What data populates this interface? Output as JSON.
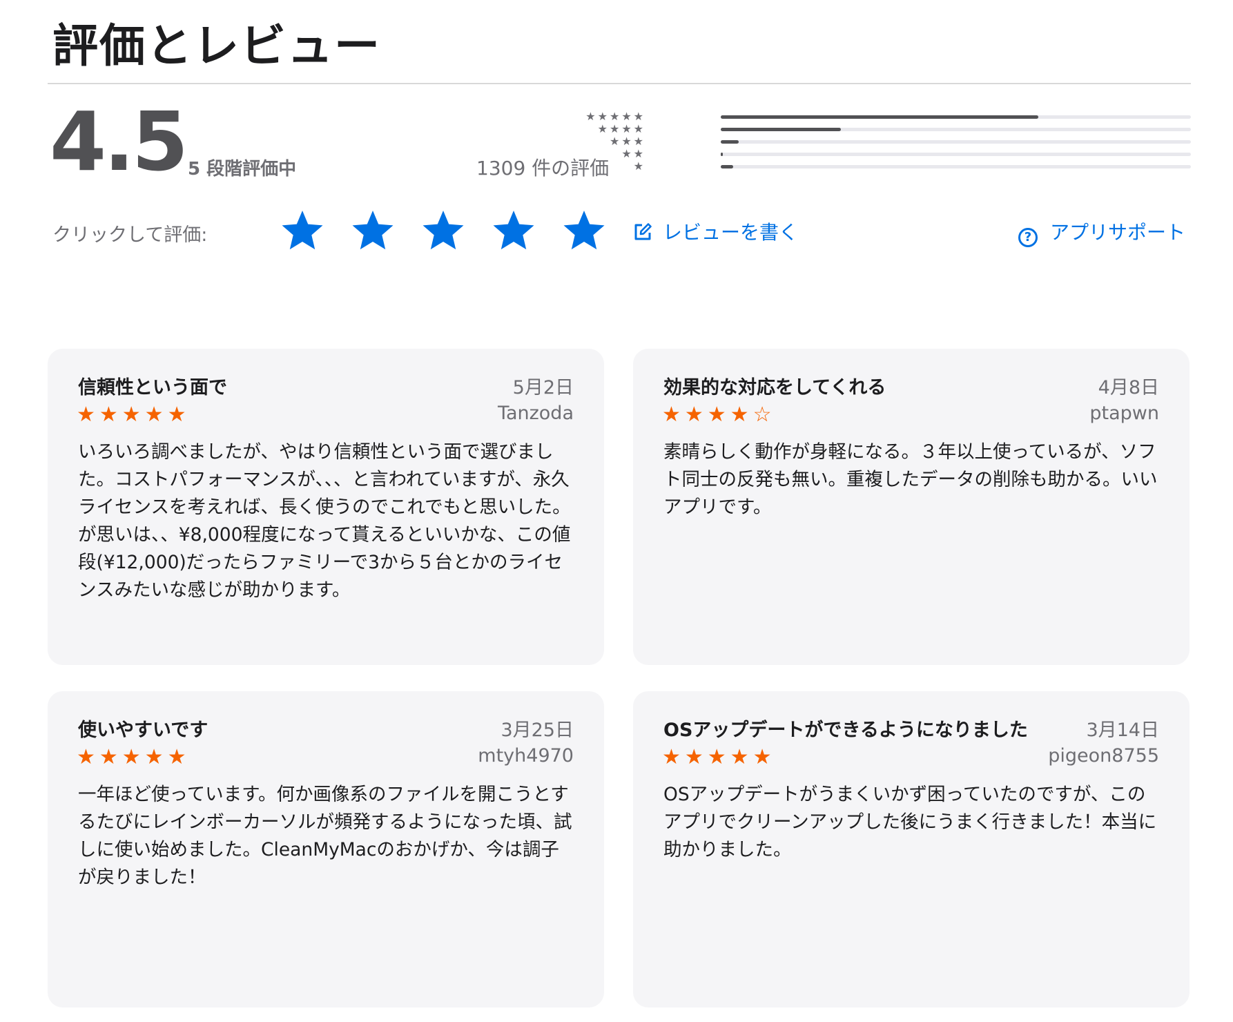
{
  "section_title": "評価とレビュー",
  "summary": {
    "average": "4.5",
    "out_of": "5 段階評価中",
    "count_label": "1309 件の評価"
  },
  "histogram": [
    {
      "stars": "★★★★★",
      "fraction": 0.675
    },
    {
      "stars": "★★★★",
      "fraction": 0.255
    },
    {
      "stars": "★★★",
      "fraction": 0.038
    },
    {
      "stars": "★★",
      "fraction": 0.004
    },
    {
      "stars": "★",
      "fraction": 0.026
    }
  ],
  "rate": {
    "label": "クリックして評価:",
    "star_count": 5,
    "star_color": "#0071e3"
  },
  "actions": {
    "write_review": "レビューを書く",
    "write_icon": "edit-icon",
    "app_support": "アプリサポート",
    "support_icon": "help-icon",
    "link_color": "#0071e3"
  },
  "star_accent": "#f56300",
  "reviews": [
    {
      "title": "信頼性という面で",
      "date": "5月2日",
      "author": "Tanzoda",
      "stars_text": "★★★★★",
      "rating": 5,
      "body": "いろいろ調べましたが、やはり信頼性という面で選びました。コストパフォーマンスが、、、と言われていますが、永久ライセンスを考えれば、長く使うのでこれでもと思いした。が思いは、、¥8,000程度になって貰えるといいかな、この値段(¥12,000)だったらファミリーで3から５台とかのライセンスみたいな感じが助かります。"
    },
    {
      "title": "効果的な対応をしてくれる",
      "date": "4月8日",
      "author": "ptapwn",
      "stars_text": "★★★★☆",
      "rating": 4,
      "body": "素晴らしく動作が身軽になる。３年以上使っているが、ソフト同士の反発も無い。重複したデータの削除も助かる。いいアプリです。"
    },
    {
      "title": "使いやすいです",
      "date": "3月25日",
      "author": "mtyh4970",
      "stars_text": "★★★★★",
      "rating": 5,
      "body": "一年ほど使っています。何か画像系のファイルを開こうとするたびにレインボーカーソルが頻発するようになった頃、試しに使い始めました。CleanMyMacのおかげか、今は調子が戻りました！"
    },
    {
      "title": "OSアップデートができるようになりました",
      "date": "3月14日",
      "author": "pigeon8755",
      "stars_text": "★★★★★",
      "rating": 5,
      "body": "OSアップデートがうまくいかず困っていたのですが、このアプリでクリーンアップした後にうまく行きました！本当に助かりました。"
    }
  ]
}
